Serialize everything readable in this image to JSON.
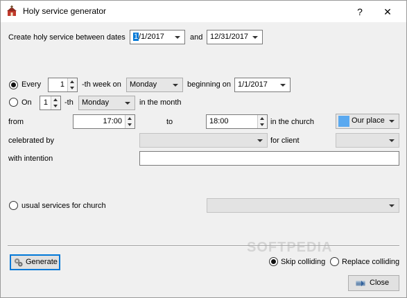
{
  "window": {
    "title": "Holy service generator",
    "help_label": "?",
    "close_label": "✕"
  },
  "dates": {
    "label": "Create holy service between dates",
    "from": "1/1/2017",
    "from_selected": "1",
    "from_rest": "/1/2017",
    "and_label": "and",
    "to": "12/31/2017"
  },
  "every": {
    "radio_label": "Every",
    "count": "1",
    "suffix": "-th week on",
    "day": "Monday",
    "beginning_label": "beginning on",
    "beginning_date": "1/1/2017"
  },
  "on": {
    "radio_label": "On",
    "count": "1",
    "suffix": "-th",
    "day": "Monday",
    "month_label": "in the month"
  },
  "time": {
    "from_label": "from",
    "from_value": "17:00",
    "to_label": "to",
    "to_value": "18:00",
    "church_label": "in the church",
    "church_value": "Our place",
    "church_color": "#5aa9f0"
  },
  "celebrated": {
    "label": "celebrated by",
    "client_label": "for client"
  },
  "intention": {
    "label": "with intention",
    "value": ""
  },
  "usual": {
    "radio_label": "usual services for church"
  },
  "footer": {
    "generate_label": "Generate",
    "skip_label": "Skip colliding",
    "replace_label": "Replace colliding",
    "close_label": "Close"
  },
  "watermark": "SOFTPEDIA",
  "colors": {
    "accent": "#0078d7",
    "window_bg": "#f0f0f0"
  }
}
